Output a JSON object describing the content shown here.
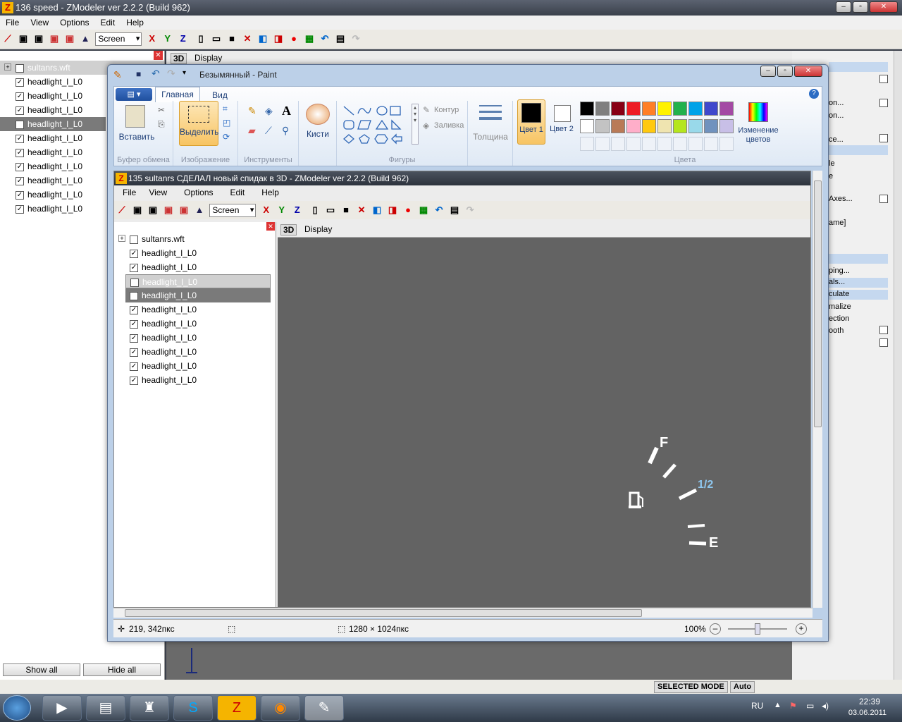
{
  "outer": {
    "title": "136 speed - ZModeler ver 2.2.2 (Build 962)",
    "menu": [
      "File",
      "View",
      "Options",
      "Edit",
      "Help"
    ],
    "screen_select": "Screen",
    "tree": {
      "root": "sultanrs.wft",
      "items": [
        "headlight_l_L0",
        "headlight_l_L0",
        "headlight_l_L0",
        "headlight_l_L0",
        "headlight_l_L0",
        "headlight_l_L0",
        "headlight_l_L0",
        "headlight_l_L0",
        "headlight_l_L0",
        "headlight_l_L0"
      ]
    },
    "view_tab": "3D",
    "view_label": "Display",
    "show_all": "Show all",
    "hide_all": "Hide all",
    "right_panel": [
      "on...",
      "e",
      "on...",
      "e...",
      "ce...",
      "le",
      "e",
      "Axes...",
      "ame]",
      "ping...",
      "als...",
      "culate",
      "malize",
      "ection",
      "ooth"
    ],
    "status_mode": "SELECTED MODE",
    "status_auto": "Auto"
  },
  "paint": {
    "title": "Безымянный - Paint",
    "tabs": [
      "Главная",
      "Вид"
    ],
    "groups": {
      "clipboard": "Буфер обмена",
      "image": "Изображение",
      "tools": "Инструменты",
      "shapes": "Фигуры",
      "colors": "Цвета"
    },
    "paste": "Вставить",
    "select": "Выделить",
    "brushes": "Кисти",
    "outline": "Контур",
    "fill": "Заливка",
    "thickness": "Толщина",
    "color1": "Цвет 1",
    "color2": "Цвет 2",
    "edit_colors": "Изменение цветов",
    "palette": [
      "#000000",
      "#7f7f7f",
      "#880015",
      "#ed1c24",
      "#ff7f27",
      "#fff200",
      "#22b14c",
      "#00a2e8",
      "#3f48cc",
      "#a349a4",
      "#ffffff",
      "#c3c3c3",
      "#b97a57",
      "#ffaec9",
      "#ffc90e",
      "#efe4b0",
      "#b5e61d",
      "#99d9ea",
      "#7092be",
      "#c8bfe7"
    ],
    "status": {
      "coords": "219, 342пкс",
      "size": "1280 × 1024пкс",
      "zoom": "100%"
    }
  },
  "inner": {
    "title": "135 sultanrs СДЕЛАЛ новый спидак в 3D - ZModeler ver 2.2.2 (Build 962)",
    "menu": [
      "File",
      "View",
      "Options",
      "Edit",
      "Help"
    ],
    "screen_select": "Screen",
    "tree": {
      "root": "sultanrs.wft",
      "items": [
        "headlight_l_L0",
        "headlight_l_L0",
        "headlight_l_L0",
        "headlight_l_L0",
        "headlight_l_L0",
        "headlight_l_L0",
        "headlight_l_L0",
        "headlight_l_L0",
        "headlight_l_L0",
        "headlight_l_L0"
      ]
    },
    "view_tab": "3D",
    "view_label": "Display",
    "gauge": {
      "f": "F",
      "half": "1/2",
      "e": "E"
    }
  },
  "taskbar": {
    "lang": "RU",
    "time": "22:39",
    "date": "03.06.2011"
  }
}
